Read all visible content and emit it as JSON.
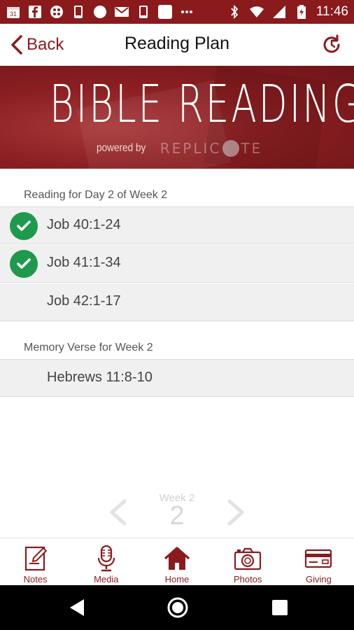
{
  "status_bar": {
    "time": "11:46",
    "calendar_day": "31",
    "left_icons": [
      "calendar-icon",
      "facebook-icon",
      "app-icon",
      "phone-icon",
      "circle-icon",
      "mail-icon",
      "phone-icon",
      "square-icon",
      "more-icon"
    ],
    "right_icons": [
      "bluetooth-icon",
      "wifi-icon",
      "signal-icon",
      "battery-icon"
    ]
  },
  "header": {
    "back_label": "Back",
    "title": "Reading Plan"
  },
  "banner": {
    "title": "BIBLE READING",
    "powered_by": "powered by",
    "brand_part1": "REPLIC",
    "brand_part2": "TE"
  },
  "reading_section": {
    "header": "Reading for Day 2 of Week 2",
    "items": [
      {
        "label": "Job 40:1-24",
        "completed": true
      },
      {
        "label": "Job 41:1-34",
        "completed": true
      },
      {
        "label": "Job 42:1-17",
        "completed": false
      }
    ]
  },
  "memory_section": {
    "header": "Memory Verse for Week 2",
    "items": [
      {
        "label": "Hebrews 11:8-10"
      }
    ]
  },
  "week_nav": {
    "label": "Week 2",
    "number": "2"
  },
  "tabs": [
    {
      "label": "Notes",
      "icon": "notes-icon"
    },
    {
      "label": "Media",
      "icon": "microphone-icon"
    },
    {
      "label": "Home",
      "icon": "home-icon"
    },
    {
      "label": "Photos",
      "icon": "camera-icon"
    },
    {
      "label": "Giving",
      "icon": "credit-card-icon"
    }
  ],
  "colors": {
    "brand": "#8b1a1d",
    "check": "#1e9a4c",
    "row_bg": "#f0f0f0"
  }
}
